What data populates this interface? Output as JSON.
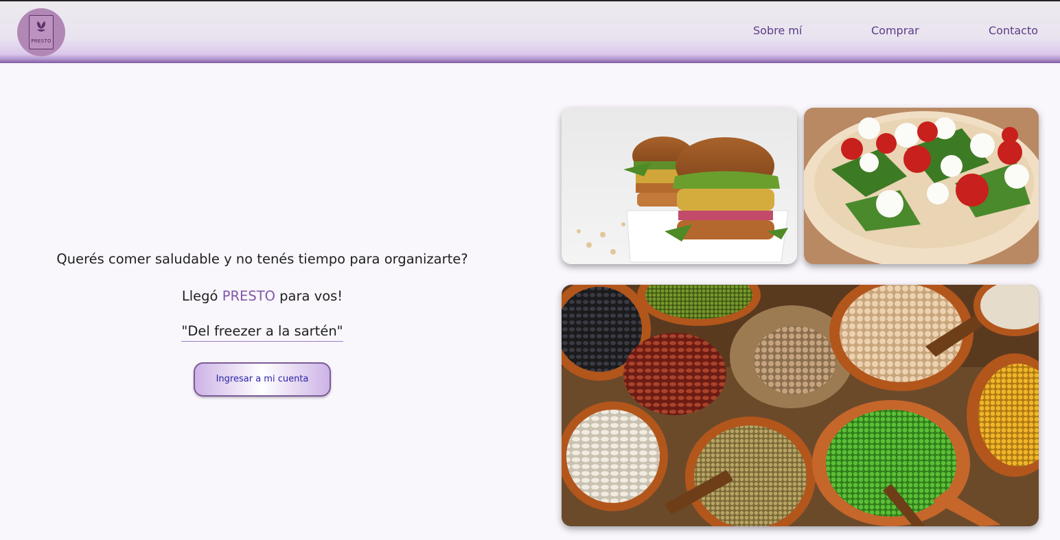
{
  "header": {
    "logo_text": "PRESTO",
    "nav": [
      {
        "label": "Sobre mí"
      },
      {
        "label": "Comprar"
      },
      {
        "label": "Contacto"
      }
    ]
  },
  "hero": {
    "question": "Querés comer saludable y no tenés tiempo para organizarte?",
    "line2_prefix": "Llegó ",
    "brand": "PRESTO",
    "line2_suffix": " para vos!",
    "slogan": "\"Del freezer a la sartén\"",
    "cta_label": "Ingresar a mi cuenta"
  },
  "images": [
    {
      "name": "veggie-burger-photo"
    },
    {
      "name": "pizza-photo"
    },
    {
      "name": "legumes-photo"
    }
  ],
  "colors": {
    "brand": "#8058a8",
    "nav_text": "#5a3c86",
    "cta_text": "#2a22a8",
    "page_background": "#f9f6fc"
  }
}
